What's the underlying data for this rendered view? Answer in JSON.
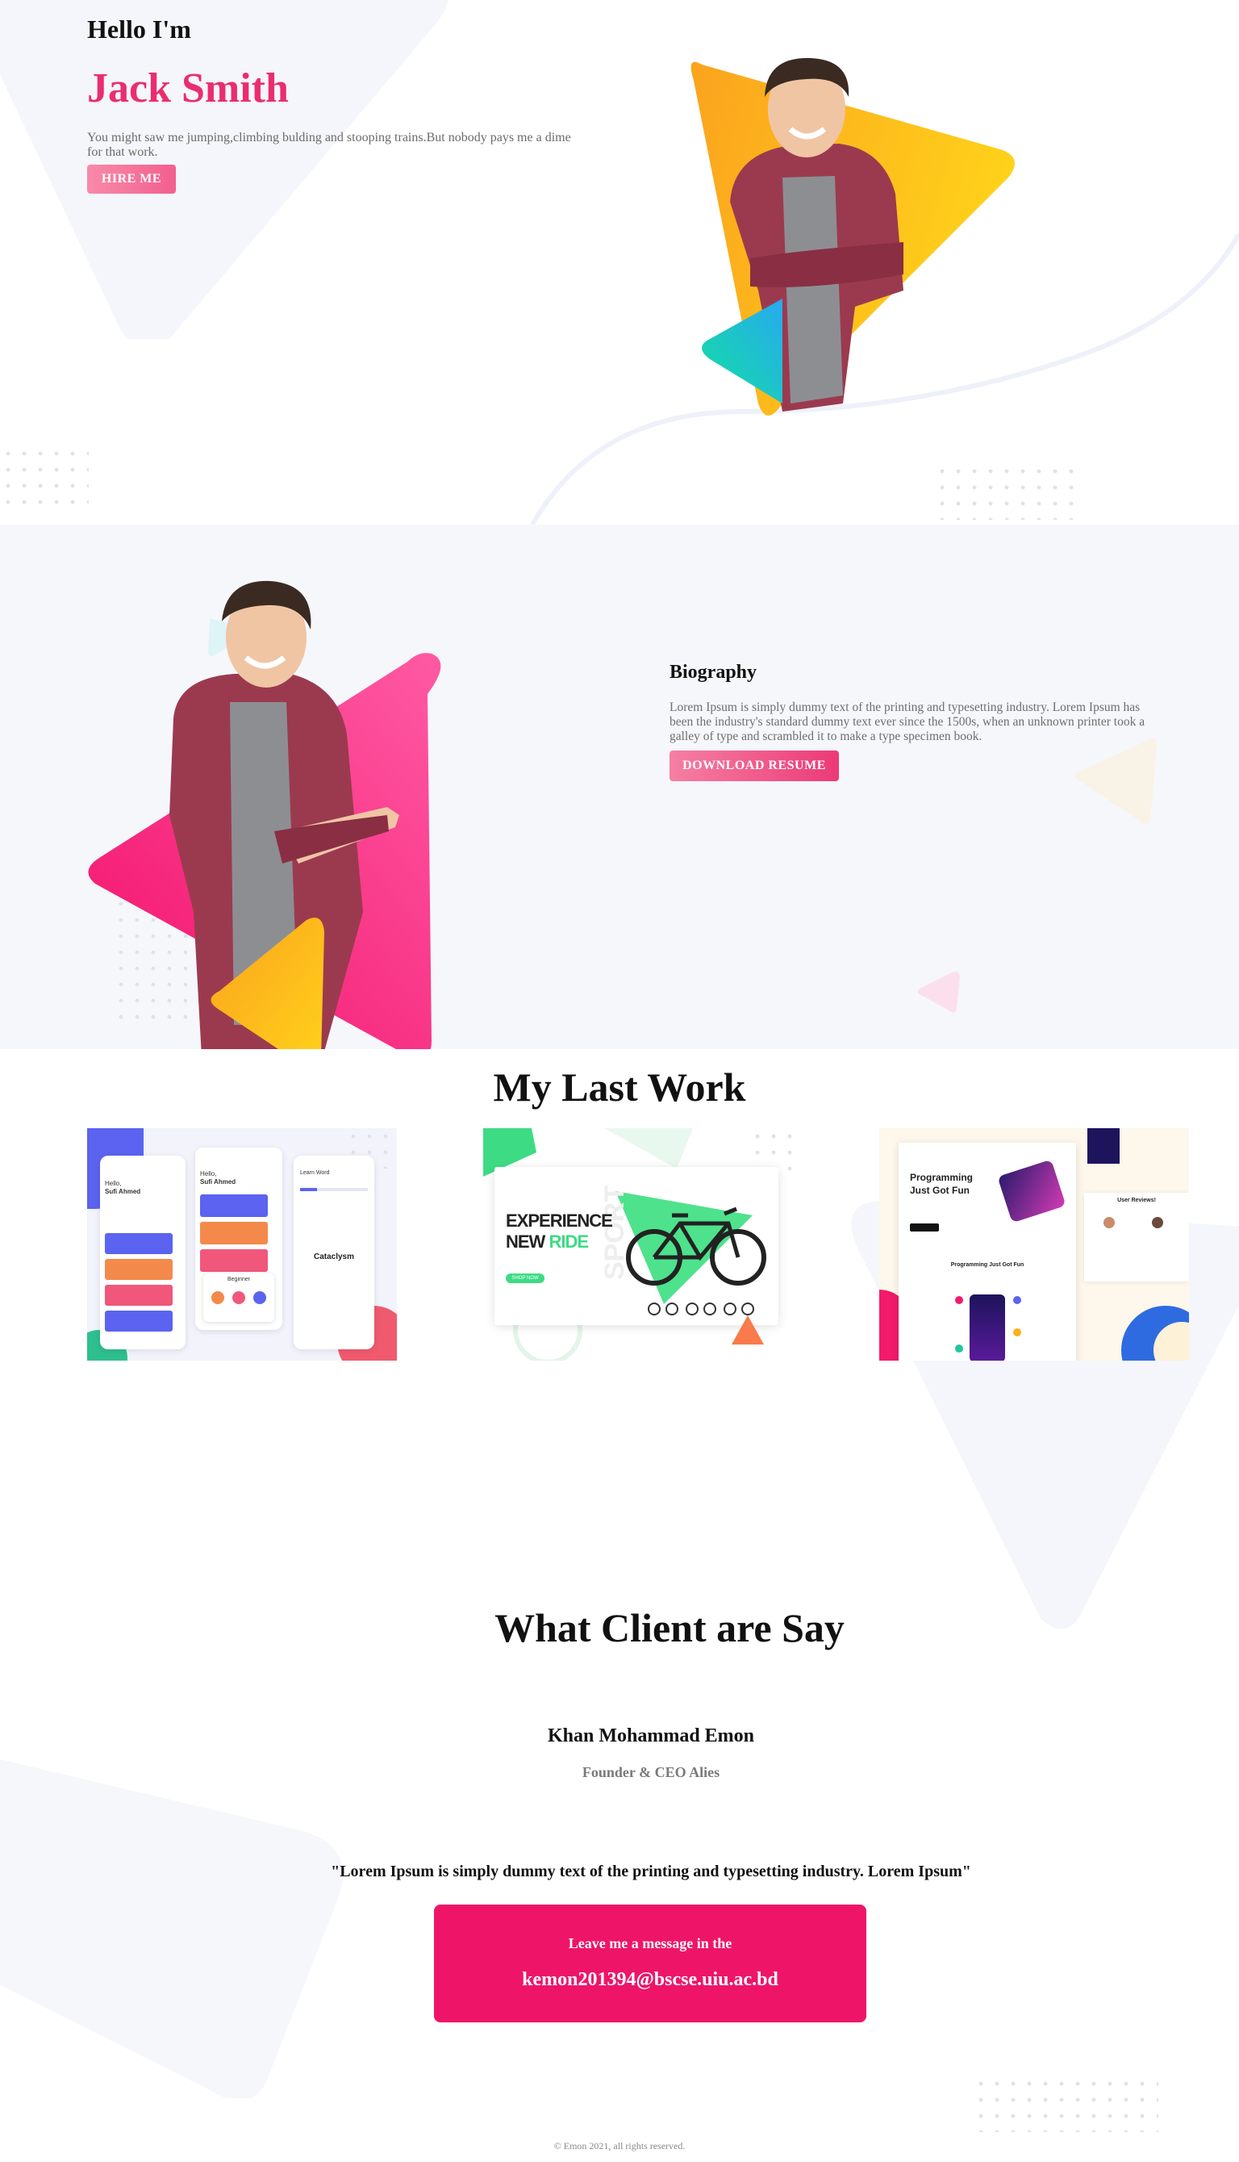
{
  "hero": {
    "greeting": "Hello I'm",
    "name": "Jack Smith",
    "intro": "You might saw me jumping,climbing bulding and stooping trains.But nobody pays me a dime for that work.",
    "hire_label": "HIRE ME",
    "colors": {
      "accent": "#ea2d6f",
      "triangle_orange": "#fbb017",
      "triangle_teal": "#18d9a6"
    }
  },
  "biography": {
    "title": "Biography",
    "text": "Lorem Ipsum is simply dummy text of the printing and typesetting industry. Lorem Ipsum has been the industry's standard dummy text ever since the 1500s, when an unknown printer took a galley of type and scrambled it to make a type specimen book.",
    "download_label": "DOWNLOAD RESUME",
    "colors": {
      "triangle_pink": "#f21a6b",
      "triangle_yellow": "#fec617"
    }
  },
  "work": {
    "title": "My Last Work",
    "projects": [
      {
        "greeting": "Hello,",
        "user": "Sufi Ahmed",
        "item": "Beginner",
        "learn_word": "Learn Word",
        "word": "Cataclysm"
      },
      {
        "headline_1": "EXPERIENCE",
        "headline_2": "NEW",
        "headline_accent": "RIDE",
        "watermark": "SPORT",
        "cta": "SHOP NOW"
      },
      {
        "headline_1": "Programming",
        "headline_2": "Just Got Fun",
        "section": "Programming Just Got Fun",
        "reviews": "User Reviews!"
      }
    ]
  },
  "client": {
    "title": "What Client are Say",
    "name": "Khan Mohammad Emon",
    "role": "Founder & CEO Alies",
    "quote": "\"Lorem Ipsum is simply dummy text of the printing and typesetting industry. Lorem Ipsum\"",
    "message_label": "Leave me a message in the",
    "email": "kemon201394@bscse.uiu.ac.bd",
    "box_color": "#ee1568"
  },
  "footer": {
    "text": "© Emon 2021, all rights reserved."
  }
}
